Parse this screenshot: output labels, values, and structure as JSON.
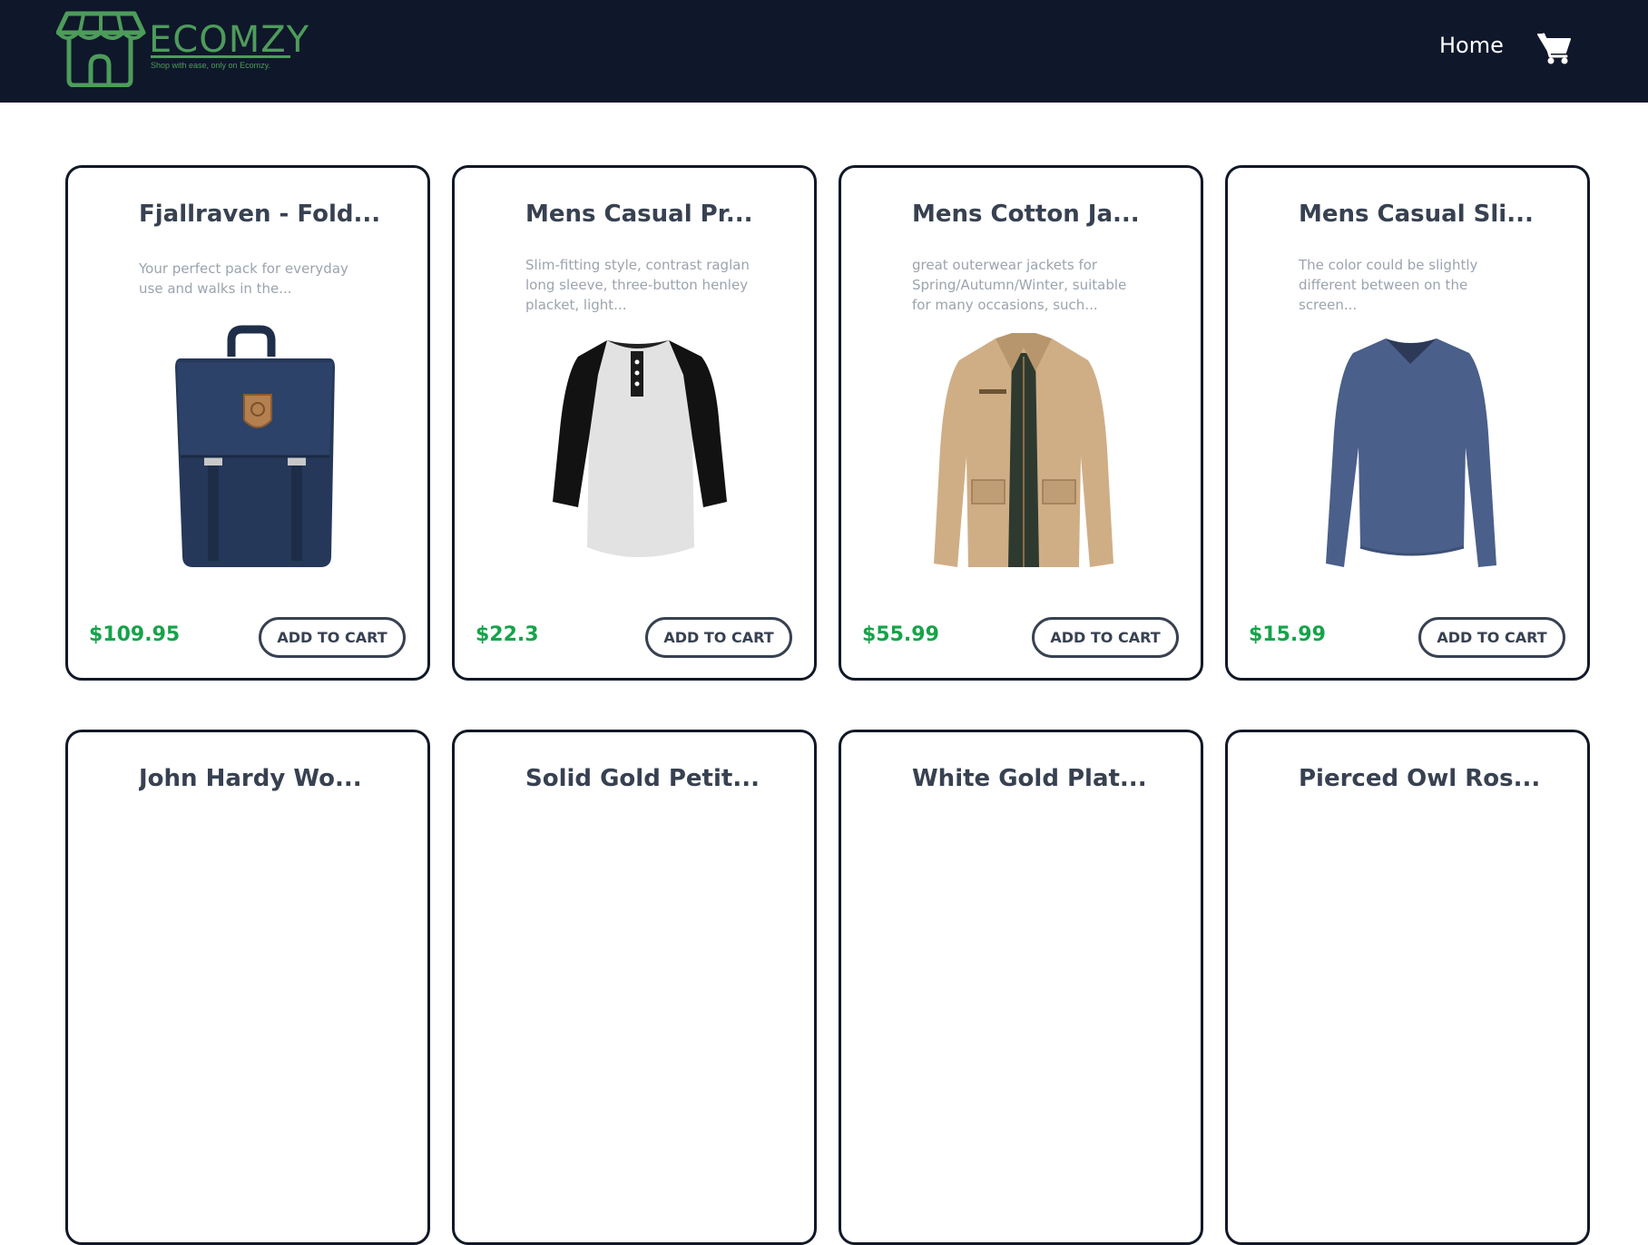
{
  "brand": {
    "name": "ECOMZY",
    "tagline": "Shop with ease, only on Ecomzy.",
    "color": "#4d9c5a"
  },
  "nav": {
    "home_label": "Home",
    "cart_icon": "shopping-cart-icon"
  },
  "colors": {
    "navbar_bg": "#0f172a",
    "price": "#16a34a",
    "title": "#374151",
    "description": "#9ca3af"
  },
  "products": [
    {
      "title": "Fjallraven - Fold...",
      "description": "Your perfect pack for everyday use and walks in the...",
      "price": "$109.95",
      "button": "ADD TO CART",
      "image": "backpack-image"
    },
    {
      "title": "Mens Casual Pr...",
      "description": "Slim-fitting style, contrast raglan long sleeve, three-button henley placket, light...",
      "price": "$22.3",
      "button": "ADD TO CART",
      "image": "raglan-shirt-image"
    },
    {
      "title": "Mens Cotton Ja...",
      "description": "great outerwear jackets for Spring/Autumn/Winter, suitable for many occasions, such...",
      "price": "$55.99",
      "button": "ADD TO CART",
      "image": "cotton-jacket-image"
    },
    {
      "title": "Mens Casual Sli...",
      "description": "The color could be slightly different between on the screen...",
      "price": "$15.99",
      "button": "ADD TO CART",
      "image": "long-sleeve-shirt-image"
    },
    {
      "title": "John Hardy Wo..."
    },
    {
      "title": "Solid Gold Petit..."
    },
    {
      "title": "White Gold Plat..."
    },
    {
      "title": "Pierced Owl Ros..."
    }
  ]
}
